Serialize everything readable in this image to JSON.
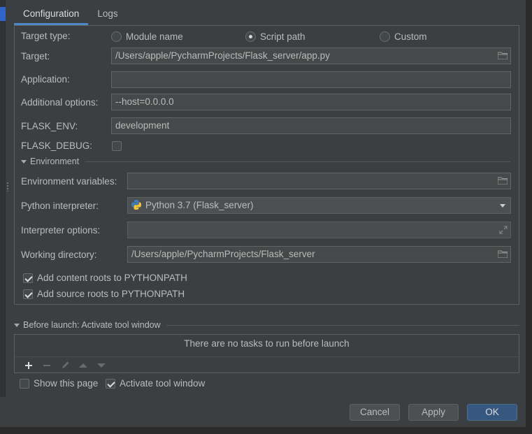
{
  "tabs": [
    {
      "label": "Configuration"
    },
    {
      "label": "Logs"
    }
  ],
  "target_type": {
    "label": "Target type:",
    "options": [
      {
        "label": "Module name",
        "checked": false
      },
      {
        "label": "Script path",
        "checked": true
      },
      {
        "label": "Custom",
        "checked": false
      }
    ]
  },
  "target": {
    "label": "Target:",
    "value": "/Users/apple/PycharmProjects/Flask_server/app.py"
  },
  "application": {
    "label": "Application:",
    "value": ""
  },
  "additional_options": {
    "label": "Additional options:",
    "value": "--host=0.0.0.0"
  },
  "flask_env": {
    "label": "FLASK_ENV:",
    "value": "development"
  },
  "flask_debug": {
    "label": "FLASK_DEBUG:",
    "checked": false
  },
  "environment": {
    "title": "Environment",
    "env_vars": {
      "label": "Environment variables:",
      "value": ""
    },
    "python_interpreter": {
      "label": "Python interpreter:",
      "value": "Python 3.7 (Flask_server)"
    },
    "interpreter_options": {
      "label": "Interpreter options:",
      "value": ""
    },
    "working_directory": {
      "label": "Working directory:",
      "value": "/Users/apple/PycharmProjects/Flask_server"
    },
    "add_content_roots": {
      "label": "Add content roots to PYTHONPATH",
      "checked": true
    },
    "add_source_roots": {
      "label": "Add source roots to PYTHONPATH",
      "checked": true
    }
  },
  "before_launch": {
    "title": "Before launch: Activate tool window",
    "empty_message": "There are no tasks to run before launch",
    "toolbar_icons": [
      "add-icon",
      "remove-icon",
      "edit-icon",
      "move-up-icon",
      "move-down-icon"
    ]
  },
  "show_this_page": {
    "label": "Show this page",
    "checked": false
  },
  "activate_tool_window": {
    "label": "Activate tool window",
    "checked": true
  },
  "buttons": {
    "cancel": "Cancel",
    "apply": "Apply",
    "ok": "OK"
  },
  "colors": {
    "accent": "#4a88c7",
    "primary_button": "#365880",
    "background": "#3c3f41",
    "selection": "#2f65ca"
  }
}
